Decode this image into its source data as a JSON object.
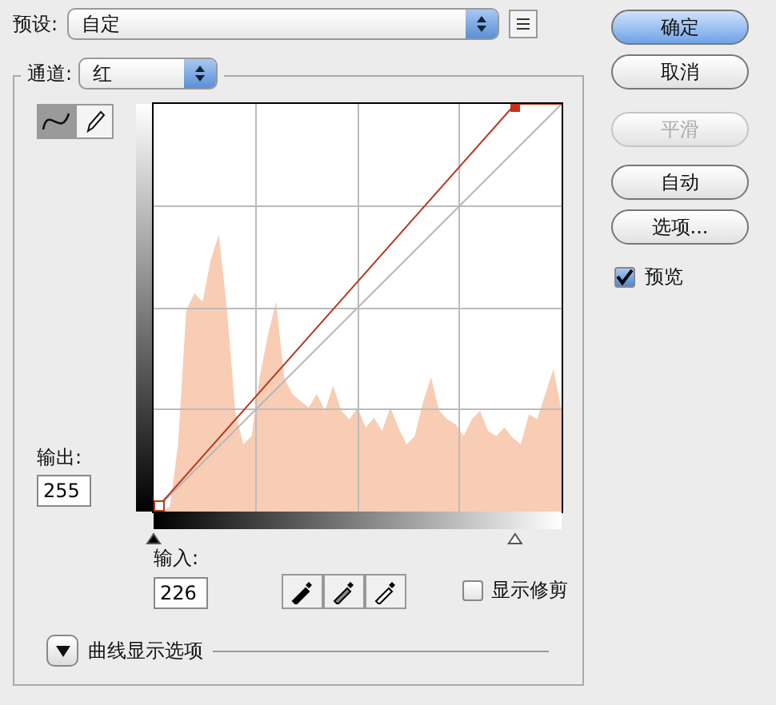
{
  "preset": {
    "label": "预设:",
    "value": "自定"
  },
  "buttons": [
    {
      "label": "确定",
      "kind": "default",
      "disabled": false
    },
    {
      "label": "取消",
      "kind": "normal",
      "disabled": false
    },
    {
      "label": "平滑",
      "kind": "normal",
      "disabled": true
    },
    {
      "label": "自动",
      "kind": "normal",
      "disabled": false
    },
    {
      "label": "选项...",
      "kind": "normal",
      "disabled": false
    }
  ],
  "preview": {
    "label": "预览",
    "checked": true
  },
  "channel": {
    "label": "通道:",
    "value": "红"
  },
  "tools": [
    {
      "kind": "curve",
      "selected": true
    },
    {
      "kind": "pencil",
      "selected": false
    }
  ],
  "output": {
    "label": "输出:",
    "value": "255"
  },
  "input": {
    "label": "输入:",
    "value": "226"
  },
  "input_sliders": [
    {
      "kind": "black",
      "level": 0
    },
    {
      "kind": "white",
      "level": 0.886
    }
  ],
  "eyedroppers": [
    {
      "kind": "black"
    },
    {
      "kind": "gray"
    },
    {
      "kind": "white"
    }
  ],
  "show_clipping": {
    "label": "显示修剪",
    "checked": false
  },
  "curve_display_options": {
    "label": "曲线显示选项",
    "expanded": false
  }
}
